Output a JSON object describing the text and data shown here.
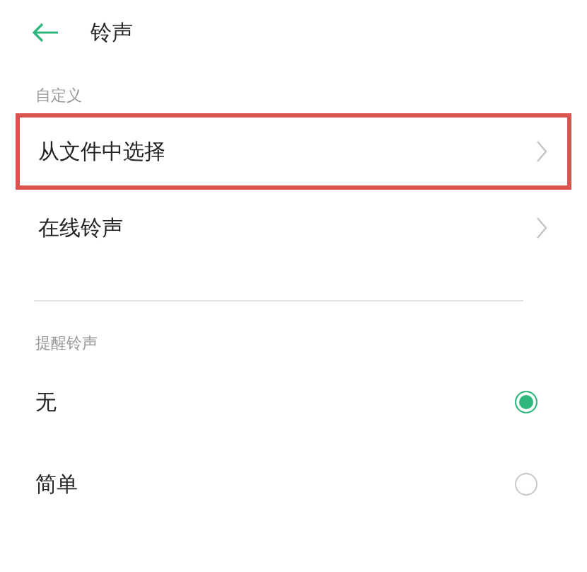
{
  "header": {
    "title": "铃声"
  },
  "custom_section": {
    "label": "自定义",
    "items": [
      {
        "label": "从文件中选择",
        "highlighted": true
      },
      {
        "label": "在线铃声",
        "highlighted": false
      }
    ]
  },
  "reminder_section": {
    "label": "提醒铃声",
    "options": [
      {
        "label": "无",
        "selected": true
      },
      {
        "label": "简单",
        "selected": false
      }
    ]
  }
}
